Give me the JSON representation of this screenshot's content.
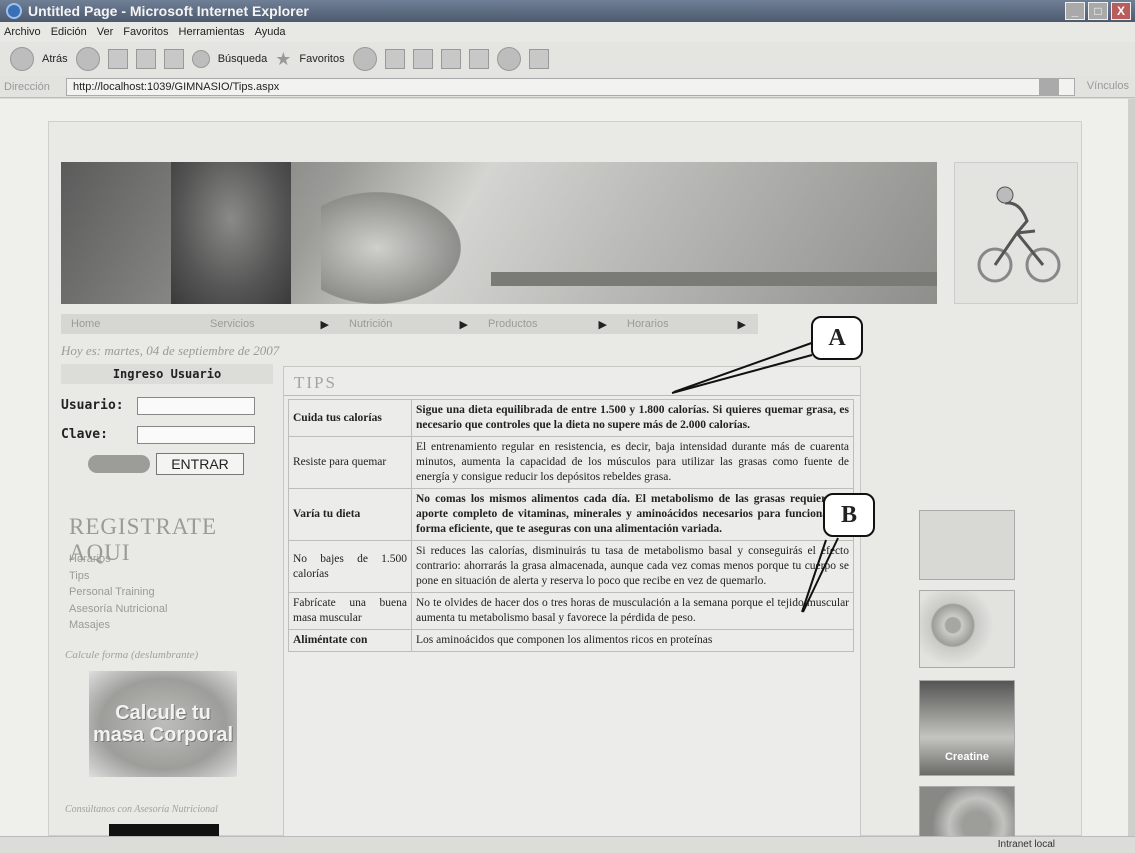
{
  "window": {
    "title": "Untitled Page - Microsoft Internet Explorer",
    "controls": [
      "_",
      "□",
      "X"
    ]
  },
  "menu": [
    "Archivo",
    "Edición",
    "Ver",
    "Favoritos",
    "Herramientas",
    "Ayuda"
  ],
  "toolbar": {
    "back": "Atrás",
    "search": "Búsqueda",
    "favorites": "Favoritos"
  },
  "address": {
    "label": "Dirección",
    "url": "http://localhost:1039/GIMNASIO/Tips.aspx",
    "go": "Ir",
    "links": "Vínculos"
  },
  "nav": [
    "Home",
    "Servicios",
    "Nutrición",
    "Productos",
    "Horarios"
  ],
  "date_text": "Hoy es: martes, 04 de septiembre de 2007",
  "login": {
    "title": "Ingreso Usuario",
    "user_label": "Usuario:",
    "pass_label": "Clave:",
    "enter_label": "ENTRAR"
  },
  "register": {
    "heading": "REGISTRATE AQUI",
    "links": [
      "Horarios",
      "Tips",
      "Personal Training",
      "Asesoría Nutricional",
      "Masajes"
    ]
  },
  "calc": {
    "heading": "Calcule forma (deslumbrante)",
    "image_text": "Calcule tu masa Corporal",
    "caption": "Consúltanos con Asesoría Nutricional"
  },
  "tips": {
    "title": "TIPS",
    "rows": [
      {
        "title": "Cuida tus calorías",
        "desc": "Sigue una dieta equilibrada de entre 1.500 y 1.800 calorías. Si quieres quemar grasa, es necesario que controles que la dieta no supere más de 2.000 calorías."
      },
      {
        "title": "Resiste para quemar",
        "desc": "El entrenamiento regular en resistencia, es decir, baja intensidad durante más de cuarenta minutos, aumenta la capacidad de los músculos para utilizar las grasas como fuente de energía y consigue reducir los depósitos rebeldes grasa."
      },
      {
        "title": "Varía tu dieta",
        "desc": "No comas los mismos alimentos cada día. El metabolismo de las grasas requiere un aporte completo de vitaminas, minerales y aminoácidos necesarios para funcionar de forma eficiente, que te aseguras con una alimentación variada."
      },
      {
        "title": "No bajes de 1.500 calorías",
        "desc": "Si reduces las calorías, disminuirás tu tasa de metabolismo basal y conseguirás el efecto contrario: ahorrarás la grasa almacenada, aunque cada vez comas menos porque tu cuerpo se pone en situación de alerta y reserva lo poco que recibe en vez de quemarlo."
      },
      {
        "title": "Fabrícate una buena masa muscular",
        "desc": "No te olvides de hacer dos o tres horas de musculación a la semana porque el tejido muscular aumenta tu metabolismo basal y favorece la pérdida de peso."
      },
      {
        "title": "Aliméntate con",
        "desc": "Los aminoácidos que componen los alimentos ricos en proteínas"
      }
    ]
  },
  "right": {
    "product_text": "Creatine"
  },
  "callouts": {
    "a": "A",
    "b": "B"
  },
  "status": {
    "zone": "Intranet local"
  }
}
